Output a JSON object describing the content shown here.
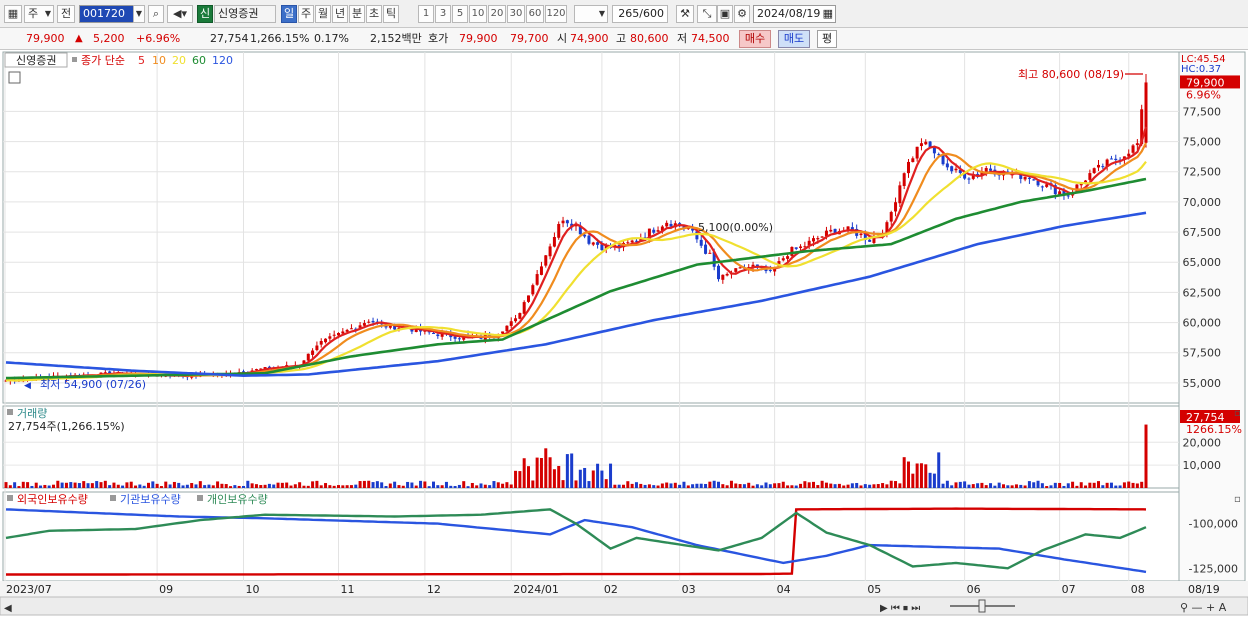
{
  "toolbar": {
    "market_type": "주",
    "prev_label": "전",
    "stock_code": "001720",
    "stock_badge": "신",
    "stock_name": "신영증권",
    "periods": [
      "일",
      "주",
      "월",
      "년",
      "분",
      "초",
      "틱"
    ],
    "active_period": "일",
    "intervals": [
      "1",
      "3",
      "5",
      "10",
      "20",
      "30",
      "60",
      "120"
    ],
    "count_current": "265",
    "count_total": "/600",
    "date": "2024/08/19"
  },
  "quote": {
    "price": "79,900",
    "change": "5,200",
    "change_pct": "+6.96%",
    "volume": "27,754",
    "volume_pct": "1,266.15%",
    "turnover": "0.17%",
    "amount": "2,152백만",
    "ask_label": "호가",
    "ask": "79,900",
    "bid": "79,700",
    "open_label": "시",
    "open": "74,900",
    "high_label": "고",
    "high": "80,600",
    "low_label": "저",
    "low": "74,500",
    "buy_label": "매수",
    "sell_label": "매도",
    "eval_label": "평"
  },
  "legend": {
    "stock_name": "신영증권",
    "ma_title": "종가 단순",
    "ma_periods": [
      "5",
      "10",
      "20",
      "60",
      "120"
    ],
    "ma_colors": [
      "#e02020",
      "#f08c1e",
      "#f0e030",
      "#1e8c32",
      "#2a55e0"
    ]
  },
  "price_panel": {
    "high_annotation": "최고 80,600 (08/19)",
    "low_annotation": "최저 54,900 (07/26)",
    "mid_annotation": "5,100(0.00%)",
    "right_lc": "LC:45.54",
    "right_hc": "HC:0.37",
    "last_price": "79,900",
    "last_pct": "6.96%",
    "y_ticks": [
      "77,500",
      "75,000",
      "72,500",
      "70,000",
      "67,500",
      "65,000",
      "62,500",
      "60,000",
      "57,500",
      "55,000"
    ]
  },
  "volume_panel": {
    "title": "거래량",
    "subtitle": "27,754주(1,266.15%)",
    "last_volume": "27,754",
    "last_pct": "1266.15%",
    "y_ticks": [
      "20,000",
      "10,000"
    ]
  },
  "holdings_panel": {
    "series": [
      "외국인보유수량",
      "기관보유수량",
      "개인보유수량"
    ],
    "series_colors": [
      "#d40000",
      "#2a55e0",
      "#2e8b57"
    ],
    "y_ticks": [
      "-100,000",
      "-125,000"
    ]
  },
  "x_axis": {
    "labels": [
      "2023/07",
      "09",
      "10",
      "11",
      "12",
      "2024/01",
      "02",
      "03",
      "04",
      "05",
      "06",
      "07",
      "08",
      "08/19"
    ]
  },
  "chart_data": {
    "type": "candlestick",
    "price_axis": {
      "min": 53500,
      "max": 80600
    },
    "anchors_price_close": [
      [
        0,
        55200
      ],
      [
        10,
        55500
      ],
      [
        25,
        55800
      ],
      [
        40,
        55600
      ],
      [
        50,
        55700
      ],
      [
        60,
        56200
      ],
      [
        68,
        56500
      ],
      [
        72,
        58200
      ],
      [
        76,
        58800
      ],
      [
        80,
        59500
      ],
      [
        84,
        60200
      ],
      [
        88,
        59700
      ],
      [
        92,
        59600
      ],
      [
        97,
        59200
      ],
      [
        103,
        58900
      ],
      [
        109,
        58700
      ],
      [
        113,
        59000
      ],
      [
        118,
        60200
      ],
      [
        122,
        63200
      ],
      [
        126,
        66500
      ],
      [
        129,
        68700
      ],
      [
        132,
        68000
      ],
      [
        135,
        66800
      ],
      [
        139,
        66200
      ],
      [
        143,
        66300
      ],
      [
        148,
        67300
      ],
      [
        153,
        68400
      ],
      [
        158,
        67800
      ],
      [
        163,
        65500
      ],
      [
        165,
        63600
      ],
      [
        169,
        64300
      ],
      [
        173,
        64700
      ],
      [
        177,
        64100
      ],
      [
        181,
        65800
      ],
      [
        184,
        66200
      ],
      [
        188,
        67000
      ],
      [
        192,
        67700
      ],
      [
        196,
        67600
      ],
      [
        200,
        66900
      ],
      [
        204,
        68000
      ],
      [
        208,
        72600
      ],
      [
        212,
        75000
      ],
      [
        215,
        74100
      ],
      [
        219,
        72600
      ],
      [
        223,
        72100
      ],
      [
        227,
        72800
      ],
      [
        232,
        72300
      ],
      [
        237,
        72100
      ],
      [
        242,
        71100
      ],
      [
        246,
        70600
      ],
      [
        251,
        72300
      ],
      [
        255,
        73200
      ],
      [
        258,
        73700
      ],
      [
        262,
        74800
      ],
      [
        264,
        79900
      ]
    ],
    "ma60": [
      [
        0,
        55400
      ],
      [
        60,
        55800
      ],
      [
        80,
        57200
      ],
      [
        100,
        58200
      ],
      [
        115,
        58600
      ],
      [
        130,
        61000
      ],
      [
        140,
        62600
      ],
      [
        160,
        64800
      ],
      [
        185,
        65900
      ],
      [
        205,
        66500
      ],
      [
        220,
        68600
      ],
      [
        235,
        70000
      ],
      [
        250,
        70900
      ],
      [
        264,
        71900
      ]
    ],
    "ma120": [
      [
        0,
        56700
      ],
      [
        30,
        56000
      ],
      [
        55,
        55600
      ],
      [
        70,
        55700
      ],
      [
        100,
        56800
      ],
      [
        125,
        58200
      ],
      [
        150,
        60200
      ],
      [
        175,
        61800
      ],
      [
        200,
        63800
      ],
      [
        225,
        66500
      ],
      [
        245,
        68000
      ],
      [
        264,
        69100
      ]
    ],
    "holdings": {
      "unit": "shares (relative)",
      "foreign": [
        [
          0,
          -128500
        ],
        [
          120,
          -128300
        ],
        [
          174,
          -128200
        ],
        [
          182,
          -128000
        ],
        [
          183,
          -92000
        ],
        [
          220,
          -91600
        ],
        [
          264,
          -92000
        ]
      ],
      "institution": [
        [
          0,
          -92000
        ],
        [
          40,
          -96000
        ],
        [
          60,
          -97000
        ],
        [
          100,
          -100000
        ],
        [
          126,
          -106000
        ],
        [
          134,
          -98000
        ],
        [
          145,
          -102000
        ],
        [
          160,
          -112000
        ],
        [
          180,
          -122000
        ],
        [
          190,
          -118000
        ],
        [
          200,
          -112000
        ],
        [
          230,
          -114000
        ],
        [
          245,
          -120000
        ],
        [
          264,
          -127000
        ]
      ],
      "individual": [
        [
          0,
          -108000
        ],
        [
          10,
          -104000
        ],
        [
          30,
          -103000
        ],
        [
          45,
          -98000
        ],
        [
          60,
          -95000
        ],
        [
          90,
          -96000
        ],
        [
          110,
          -95000
        ],
        [
          126,
          -92000
        ],
        [
          132,
          -100000
        ],
        [
          140,
          -114000
        ],
        [
          146,
          -108000
        ],
        [
          165,
          -115000
        ],
        [
          175,
          -108000
        ],
        [
          183,
          -94000
        ],
        [
          190,
          -105000
        ],
        [
          200,
          -112000
        ],
        [
          210,
          -124000
        ],
        [
          220,
          -122000
        ],
        [
          232,
          -125000
        ],
        [
          240,
          -115000
        ],
        [
          250,
          -106000
        ],
        [
          258,
          -108000
        ],
        [
          264,
          -102000
        ]
      ]
    }
  }
}
